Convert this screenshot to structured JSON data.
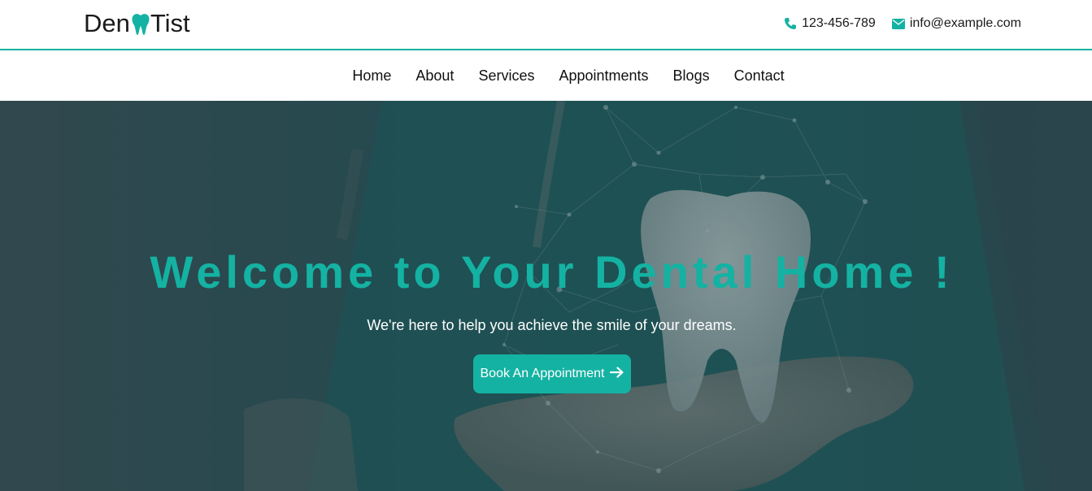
{
  "header": {
    "logo_left": "Den",
    "logo_right": "Tist",
    "phone": "123-456-789",
    "email": "info@example.com",
    "icons": {
      "phone": "phone-icon",
      "email": "envelope-icon",
      "logo": "tooth-icon"
    }
  },
  "nav": {
    "items": [
      {
        "label": "Home"
      },
      {
        "label": "About"
      },
      {
        "label": "Services"
      },
      {
        "label": "Appointments"
      },
      {
        "label": "Blogs"
      },
      {
        "label": "Contact"
      }
    ]
  },
  "hero": {
    "title": "Welcome to Your Dental Home !",
    "subtitle": "We're here to help you achieve the smile of your dreams.",
    "cta_label": "Book An Appointment",
    "cta_icon": "arrow-right-icon"
  },
  "colors": {
    "accent": "#14b2a2",
    "text": "#111111",
    "hero_overlay": "#1f3d42"
  }
}
